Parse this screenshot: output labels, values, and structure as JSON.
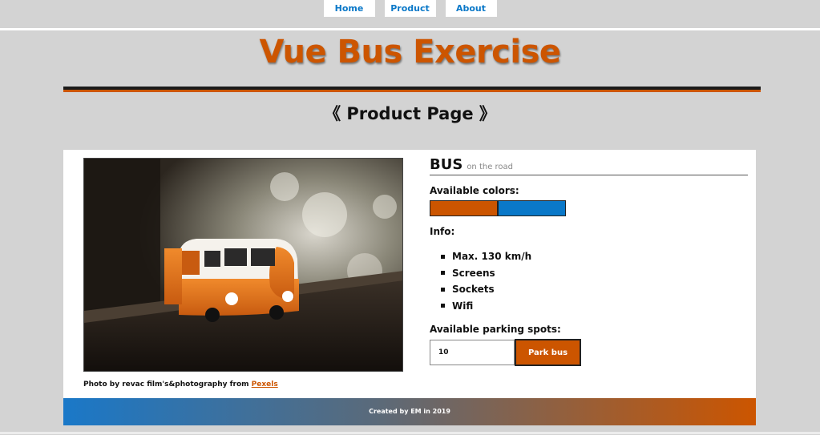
{
  "nav": {
    "items": [
      {
        "label": "Home"
      },
      {
        "label": "Product"
      },
      {
        "label": "About"
      }
    ]
  },
  "site_title": "Vue Bus Exercise",
  "page_subtitle": "《 Product Page 》",
  "product": {
    "name": "BUS",
    "tagline": "on the road",
    "colors_label": "Available colors:",
    "colors": [
      "#cc5500",
      "#0a78c8"
    ],
    "info_label": "Info:",
    "features": [
      "Max. 130 km/h",
      "Screens",
      "Sockets",
      "Wifi"
    ],
    "parking_label": "Available parking spots:",
    "parking_value": "10",
    "park_button": "Park bus"
  },
  "photo_credit": {
    "text": "Photo by revac film's&photography from ",
    "link": "Pexels"
  },
  "footer": "Created by EM in 2019",
  "accent_colors": {
    "brand": "#cc5500",
    "link": "#0a78c8",
    "background": "#d3d3d3"
  }
}
